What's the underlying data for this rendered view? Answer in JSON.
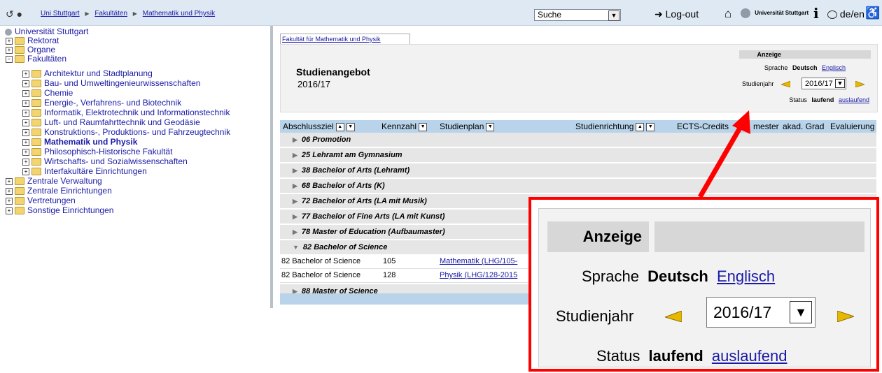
{
  "topbar": {
    "breadcrumbs": [
      "Uni Stuttgart",
      "Fakultäten",
      "Mathematik und Physik"
    ],
    "search_value": "Suche",
    "logout_label": "Log-out",
    "uni_logo_text": "Universität Stuttgart",
    "lang_label": "de/en",
    "info_glyph": "i",
    "icons": [
      "back-icon",
      "forward-icon",
      "home-icon",
      "info-icon",
      "globe-icon",
      "accessibility-icon"
    ]
  },
  "tree": {
    "root": "Universität Stuttgart",
    "items": [
      {
        "label": "Rektorat"
      },
      {
        "label": "Organe"
      },
      {
        "label": "Fakultäten"
      },
      {
        "label": "Architektur und Stadtplanung"
      },
      {
        "label": "Bau- und Umweltingenieurwissenschaften"
      },
      {
        "label": "Chemie"
      },
      {
        "label": "Energie-, Verfahrens- und Biotechnik"
      },
      {
        "label": "Informatik, Elektrotechnik und Informationstechnik"
      },
      {
        "label": "Luft- und Raumfahrttechnik und Geodäsie"
      },
      {
        "label": "Konstruktions-, Produktions- und Fahrzeugtechnik"
      },
      {
        "label": "Mathematik und Physik"
      },
      {
        "label": "Philosophisch-Historische Fakultät"
      },
      {
        "label": "Wirtschafts- und Sozialwissenschaften"
      },
      {
        "label": "Interfakultäre Einrichtungen"
      },
      {
        "label": "Zentrale Verwaltung"
      },
      {
        "label": "Zentrale Einrichtungen"
      },
      {
        "label": "Vertretungen"
      },
      {
        "label": "Sonstige Einrichtungen"
      }
    ],
    "expand_glyph": "+",
    "collapse_glyph": "−"
  },
  "tab": "Fakultät für Mathematik und Physik",
  "heading": {
    "title": "Studienangebot",
    "year": "2016/17"
  },
  "anzeige": {
    "header": "Anzeige",
    "sprache_label": "Sprache",
    "sprache_active": "Deutsch",
    "sprache_other": "Englisch",
    "jahr_label": "Studienjahr",
    "jahr_value": "2016/17",
    "status_label": "Status",
    "status_active": "laufend",
    "status_other": "auslaufend"
  },
  "table": {
    "columns": [
      "Abschlussziel",
      "Kennzahl",
      "Studienplan",
      "Studienrichtung",
      "ECTS-Credits",
      "Semester",
      "akad. Grad",
      "Evaluierung"
    ],
    "columns_visible": [
      "Abschlussziel",
      "Kennzahl",
      "Studienplan",
      "Studienrichtung",
      "ECTS-Credits",
      "mester",
      "akad. Grad",
      "Evaluierung"
    ],
    "groups": [
      "06 Promotion",
      "25 Lehramt am Gymnasium",
      "38 Bachelor of Arts (Lehramt)",
      "68 Bachelor of Arts (K)",
      "72 Bachelor of Arts (LA mit Musik)",
      "77 Bachelor of Fine Arts (LA mit Kunst)",
      "78 Master of Education (Aufbaumaster)",
      "82 Bachelor of Science",
      "88 Master of Science"
    ],
    "rows": [
      {
        "abschluss": "82 Bachelor of Science",
        "kennzahl": "105",
        "plan": "Mathematik (LHG/105-"
      },
      {
        "abschluss": "82 Bachelor of Science",
        "kennzahl": "128",
        "plan": "Physik (LHG/128-2015"
      }
    ]
  },
  "colors": {
    "link": "#1a1aa6",
    "accent_red": "#ff0000",
    "table_header": "#b9d3ea",
    "arrow": "#e6b800"
  }
}
